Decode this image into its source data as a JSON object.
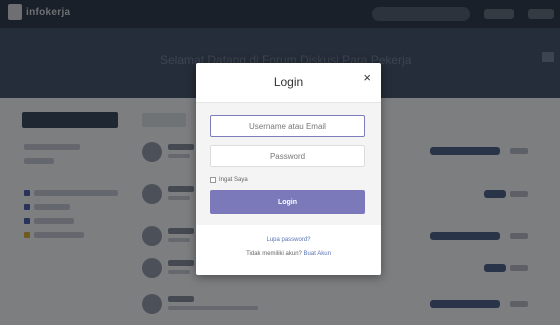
{
  "site": {
    "logo_text": "infokerja"
  },
  "hero": {
    "title": "Selamat Datang di Forum Diskusi Para Pekerja"
  },
  "login_modal": {
    "title": "Login",
    "close_symbol": "×",
    "username_placeholder": "Username atau Email",
    "password_placeholder": "Password",
    "remember_label": "Ingat Saya",
    "login_button": "Login",
    "forgot_password": "Lupa password?",
    "no_account_text": "Tidak memiliki akun?",
    "signup_link": "Buat Akun"
  },
  "colors": {
    "accent": "#7b79ba",
    "header": "#2e3b4e",
    "link": "#5b73b6"
  }
}
